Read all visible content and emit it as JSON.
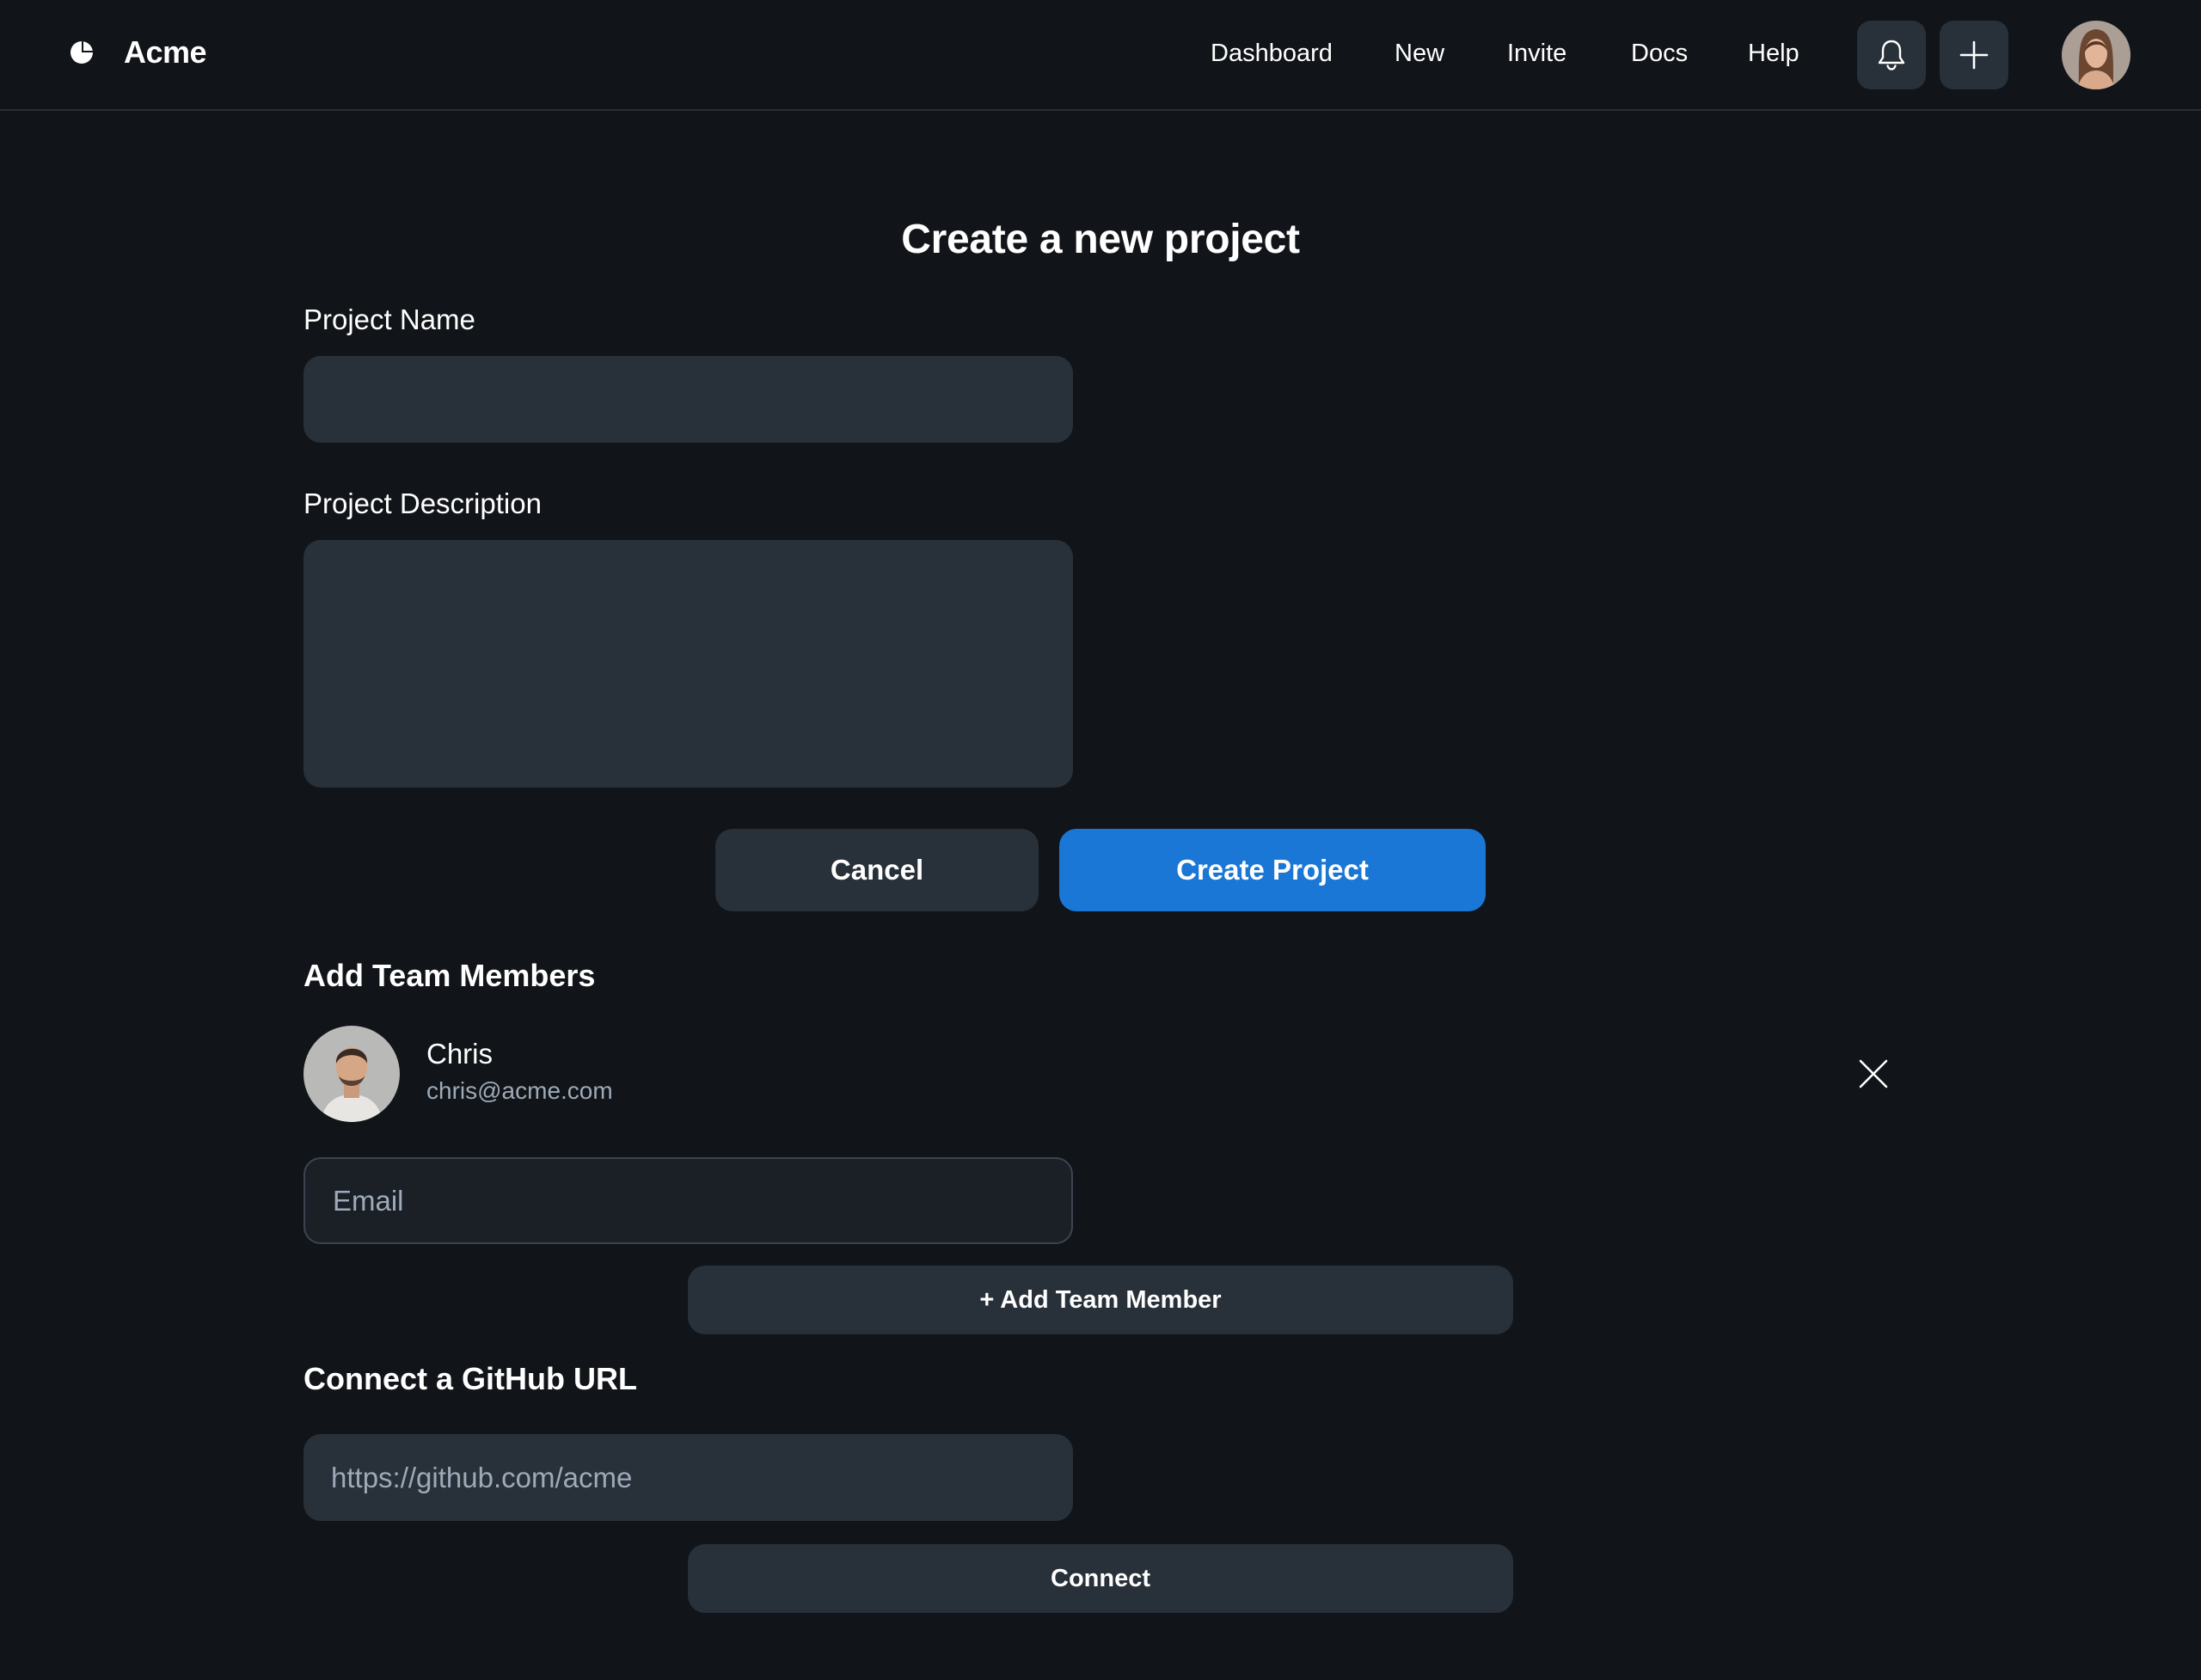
{
  "header": {
    "brand": "Acme",
    "nav": [
      "Dashboard",
      "New",
      "Invite",
      "Docs",
      "Help"
    ],
    "icons": [
      "bell-icon",
      "plus-icon"
    ]
  },
  "form": {
    "title": "Create a new project",
    "project_name_label": "Project Name",
    "project_name_value": "",
    "project_description_label": "Project Description",
    "project_description_value": "",
    "cancel_label": "Cancel",
    "create_label": "Create Project"
  },
  "team": {
    "title": "Add Team Members",
    "members": [
      {
        "name": "Chris",
        "email": "chris@acme.com"
      }
    ],
    "email_placeholder": "Email",
    "add_label": "+ Add Team Member"
  },
  "github": {
    "title": "Connect a GitHub URL",
    "placeholder": "https://github.com/acme",
    "connect_label": "Connect"
  },
  "colors": {
    "background": "#111418",
    "surface": "#283039",
    "accent": "#1a77d6",
    "muted_text": "#9eaab8"
  }
}
